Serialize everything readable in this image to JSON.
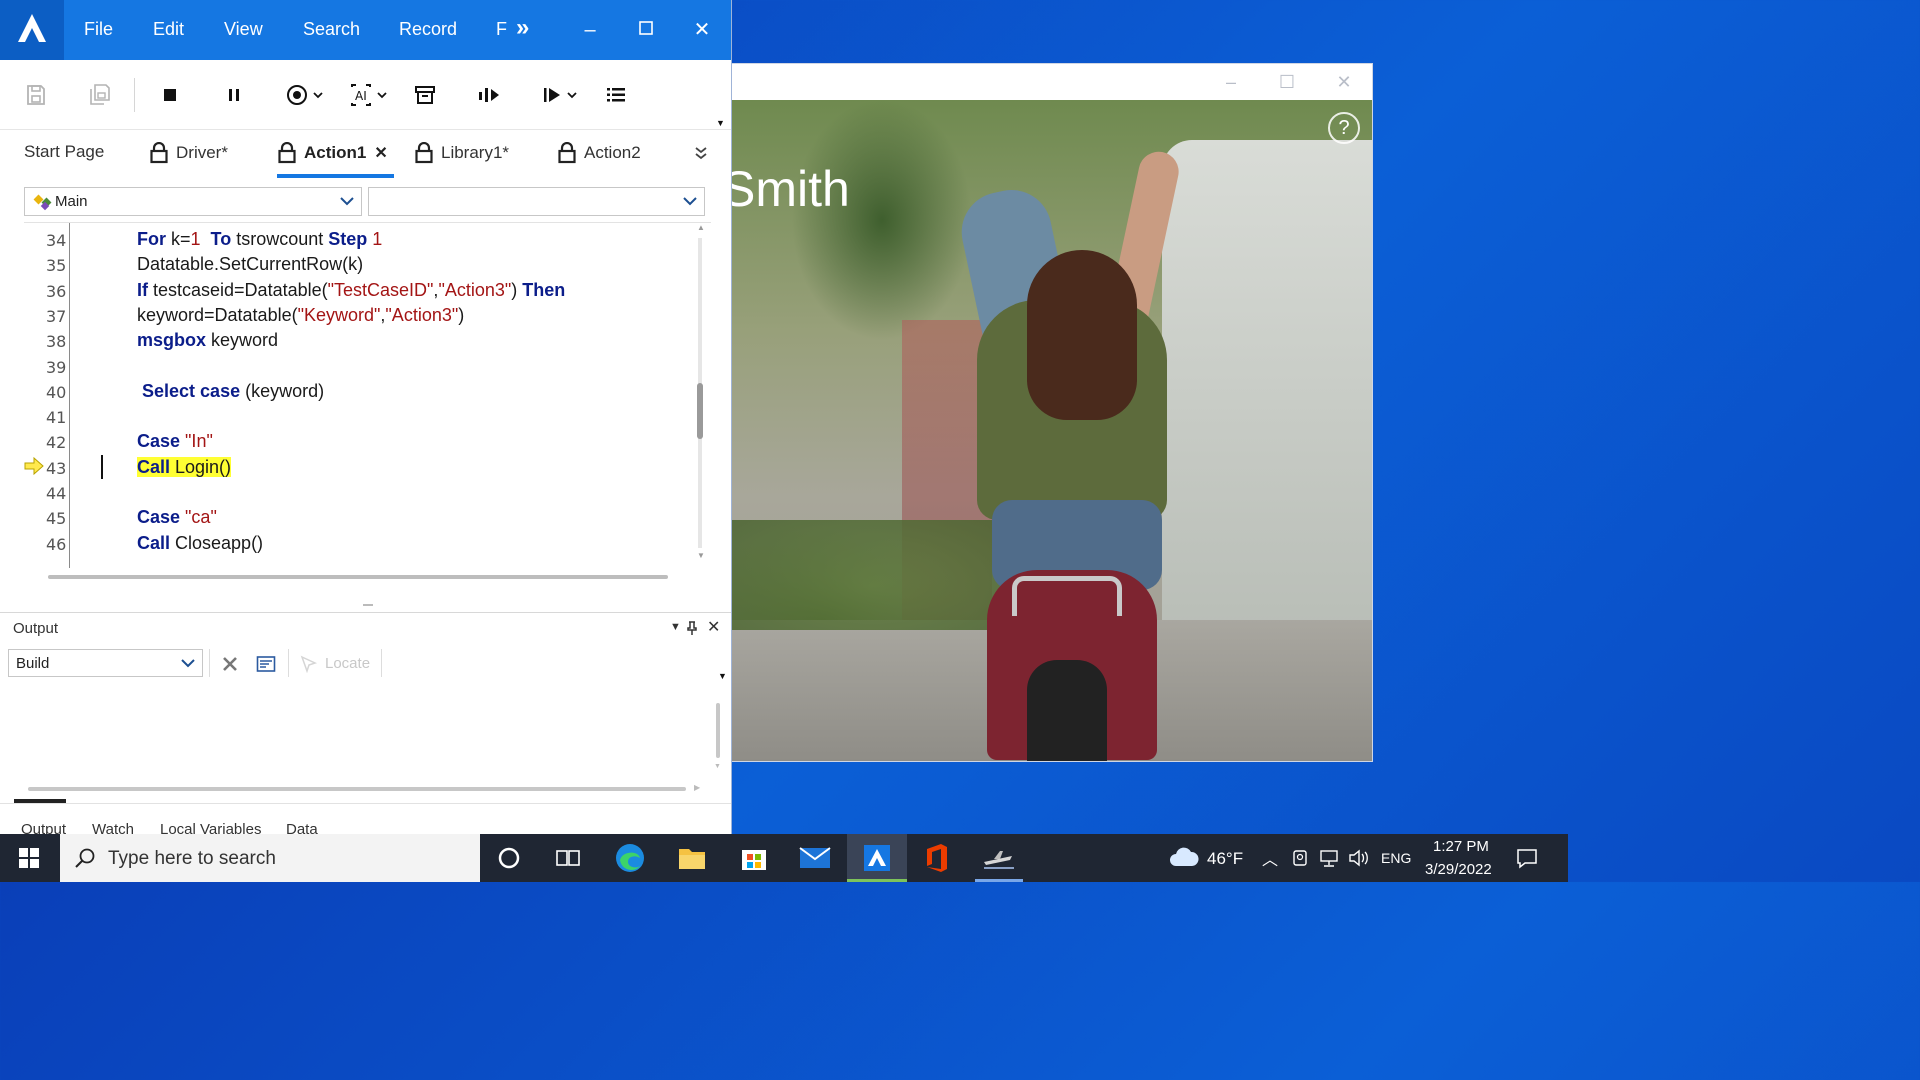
{
  "colors": {
    "accent": "#1577e2",
    "keyword": "#0b1d8a",
    "string": "#a31515",
    "highlight": "#ffff33",
    "taskbar": "#1f2633"
  },
  "photo_window": {
    "title_text": "Smith",
    "help_glyph": "?"
  },
  "menu": {
    "items": [
      "File",
      "Edit",
      "View",
      "Search",
      "Record",
      "F"
    ],
    "overflow": "»"
  },
  "tabs": {
    "items": [
      "Start Page",
      "Driver*",
      "Action1",
      "Library1*",
      "Action2"
    ],
    "close_glyph": "✕"
  },
  "editor": {
    "procedure_combo": "Main",
    "lines": [
      {
        "num": "34",
        "parts": [
          [
            "kw",
            "For "
          ],
          [
            "n",
            "k="
          ],
          [
            "num",
            "1"
          ],
          [
            "n",
            "  "
          ],
          [
            "kw",
            "To "
          ],
          [
            "n",
            "tsrowcount "
          ],
          [
            "kw",
            "Step "
          ],
          [
            "num",
            "1"
          ]
        ]
      },
      {
        "num": "35",
        "parts": [
          [
            "n",
            "Datatable.SetCurrentRow(k)"
          ]
        ]
      },
      {
        "num": "36",
        "parts": [
          [
            "kw",
            "If "
          ],
          [
            "n",
            "testcaseid=Datatable("
          ],
          [
            "str",
            "\"TestCaseID\""
          ],
          [
            "n",
            ","
          ],
          [
            "str",
            "\"Action3\""
          ],
          [
            "n",
            ") "
          ],
          [
            "kw",
            "Then"
          ]
        ]
      },
      {
        "num": "37",
        "parts": [
          [
            "n",
            "keyword=Datatable("
          ],
          [
            "str",
            "\"Keyword\""
          ],
          [
            "n",
            ","
          ],
          [
            "str",
            "\"Action3\""
          ],
          [
            "n",
            ")"
          ]
        ]
      },
      {
        "num": "38",
        "parts": [
          [
            "kw",
            "msgbox "
          ],
          [
            "n",
            "keyword"
          ]
        ]
      },
      {
        "num": "39",
        "parts": []
      },
      {
        "num": "40",
        "parts": [
          [
            "n",
            " "
          ],
          [
            "kw",
            "Select case "
          ],
          [
            "n",
            "(keyword)"
          ]
        ]
      },
      {
        "num": "41",
        "parts": []
      },
      {
        "num": "42",
        "parts": [
          [
            "kw",
            "Case "
          ],
          [
            "str",
            "\"In\""
          ]
        ]
      },
      {
        "num": "43",
        "parts": [
          [
            "hlkw",
            "Call "
          ],
          [
            "hl",
            "Login()"
          ]
        ]
      },
      {
        "num": "44",
        "parts": []
      },
      {
        "num": "45",
        "parts": [
          [
            "kw",
            "Case "
          ],
          [
            "str",
            "\"ca\""
          ]
        ]
      },
      {
        "num": "46",
        "parts": [
          [
            "kw",
            "Call "
          ],
          [
            "n",
            "Closeapp()"
          ]
        ]
      }
    ]
  },
  "output": {
    "title": "Output",
    "build_combo": "Build",
    "locate_label": "Locate",
    "bottom_tabs": [
      "Output",
      "Watch",
      "Local Variables",
      "Data"
    ]
  },
  "taskbar": {
    "search_placeholder": "Type here to search",
    "weather_temp": "46°F",
    "language": "ENG",
    "time": "1:27 PM",
    "date": "3/29/2022"
  }
}
